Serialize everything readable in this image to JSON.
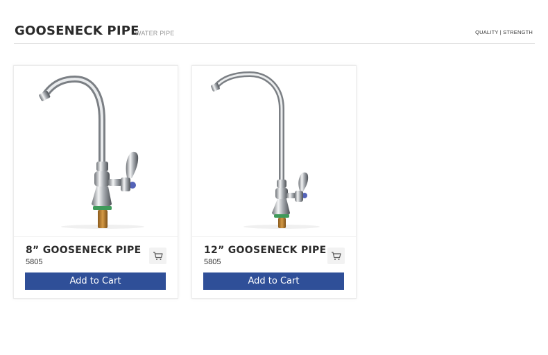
{
  "header": {
    "title": "GOOSENECK PIPE",
    "subtitle": "WATER PIPE",
    "tagline": "QUALITY | STRENGTH"
  },
  "products": [
    {
      "name": "8” GOOSENECK PIPE",
      "code": "5805",
      "button_label": "Add to Cart",
      "image_icon": "faucet-image",
      "cart_icon": "cart-icon"
    },
    {
      "name": "12” GOOSENECK PIPE",
      "code": "5805",
      "button_label": "Add to Cart",
      "image_icon": "faucet-image",
      "cart_icon": "cart-icon"
    }
  ],
  "colors": {
    "button_bg": "#2f4f98",
    "button_text": "#ffffff",
    "title_text": "#2a2a2a",
    "subtitle_text": "#9a9a9a"
  }
}
